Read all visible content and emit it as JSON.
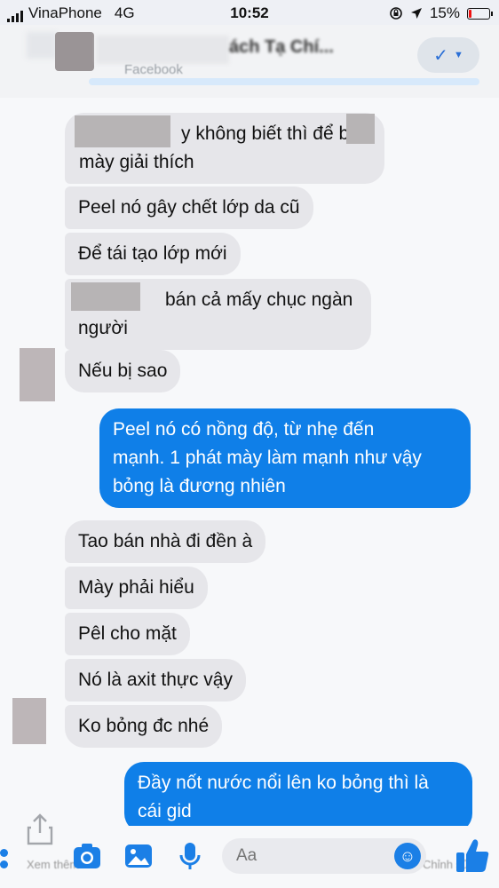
{
  "status_bar": {
    "carrier": "VinaPhone",
    "network": "4G",
    "time": "10:52",
    "battery": "15%",
    "battery_level": 0.15,
    "icons": [
      "signal-bars-icon",
      "orientation-lock-icon",
      "location-arrow-icon",
      "battery-icon"
    ]
  },
  "header": {
    "title": "ách Tạ Chí...",
    "subtitle": "Facebook",
    "action_icon": "checkmark-icon"
  },
  "messages": [
    {
      "id": "m1",
      "side": "received",
      "lines": [
        "y không biết thì để b",
        "mày giải thích"
      ]
    },
    {
      "id": "m2",
      "side": "received",
      "lines": [
        "Peel nó gây chết lớp da cũ"
      ]
    },
    {
      "id": "m3",
      "side": "received",
      "lines": [
        "Để tái tạo lớp mới"
      ]
    },
    {
      "id": "m4",
      "side": "received",
      "lines": [
        "bán cả mấy chục ngàn",
        "người"
      ]
    },
    {
      "id": "m5",
      "side": "received",
      "lines": [
        "Nếu bị sao"
      ]
    },
    {
      "id": "m6",
      "side": "sent",
      "lines": [
        "Peel nó có nồng độ, từ nhẹ đến",
        "mạnh. 1 phát mày làm mạnh như vậy",
        "bỏng là đương nhiên"
      ]
    },
    {
      "id": "m7",
      "side": "received",
      "lines": [
        "Tao bán nhà đi đền à"
      ]
    },
    {
      "id": "m8",
      "side": "received",
      "lines": [
        "Mày phải hiểu"
      ]
    },
    {
      "id": "m9",
      "side": "received",
      "lines": [
        "Pêl cho mặt"
      ]
    },
    {
      "id": "m10",
      "side": "received",
      "lines": [
        "Nó là axit thực vậy"
      ]
    },
    {
      "id": "m11",
      "side": "received",
      "lines": [
        "Ko bỏng đc nhé"
      ]
    },
    {
      "id": "m12",
      "side": "sent",
      "lines": [
        "Đầy nốt nước nổi lên ko bỏng thì là",
        "cái gid"
      ]
    }
  ],
  "composer": {
    "placeholder": "Aa",
    "left_label": "Xem thêm",
    "right_label": "Chỉnh sửa",
    "icons": [
      "more-dots-icon",
      "camera-icon",
      "image-icon",
      "microphone-icon",
      "emoji-icon",
      "thumbs-up-icon",
      "share-icon"
    ]
  },
  "colors": {
    "sent_bubble": "#0f7fe8",
    "received_bubble": "#e6e6ea",
    "accent": "#1b7fe6"
  }
}
